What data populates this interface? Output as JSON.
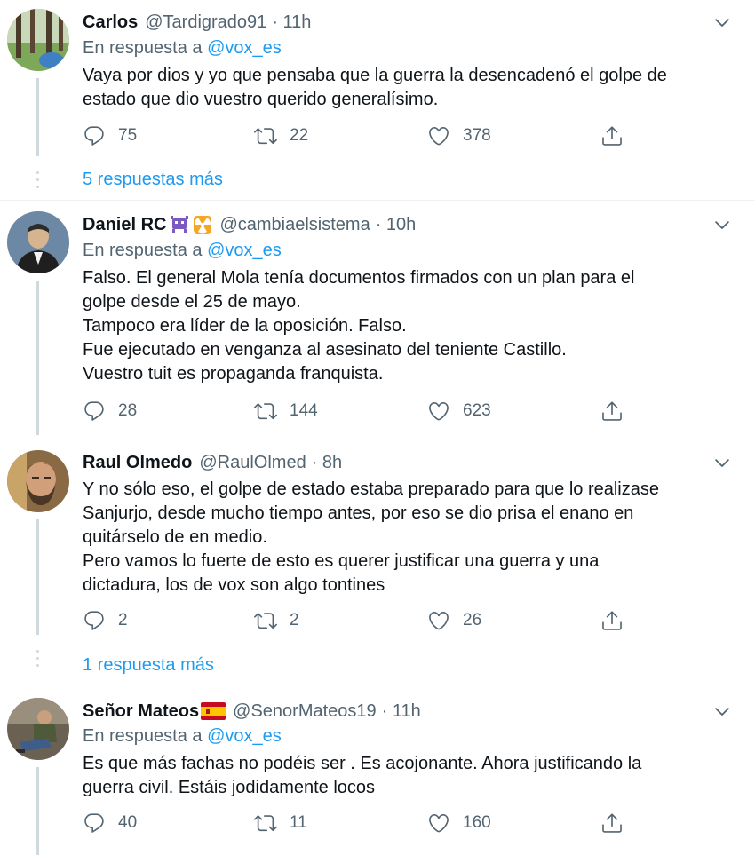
{
  "tweets": [
    {
      "name": "Carlos",
      "handle": "@Tardigrado91",
      "time": "· 11h",
      "reply_prefix": "En respuesta a",
      "reply_mention": "@vox_es",
      "lines": [
        "Vaya por dios y yo que pensaba que la guerra la desencadenó el golpe de",
        "estado que dio vuestro querido generalísimo."
      ],
      "replies": "75",
      "retweets": "22",
      "likes": "378",
      "more": "5 respuestas más"
    },
    {
      "name": "Daniel RC",
      "handle": "@cambiaelsistema",
      "time": "· 10h",
      "reply_prefix": "En respuesta a",
      "reply_mention": "@vox_es",
      "lines": [
        "Falso. El general Mola tenía documentos firmados con un plan para el",
        "golpe desde el 25 de mayo.",
        "Tampoco era líder de la oposición. Falso.",
        "Fue ejecutado en venganza al asesinato del teniente Castillo.",
        "Vuestro tuit es propaganda franquista."
      ],
      "replies": "28",
      "retweets": "144",
      "likes": "623"
    },
    {
      "name": "Raul Olmedo",
      "handle": "@RaulOlmed",
      "time": "· 8h",
      "lines": [
        "Y no sólo eso, el golpe de estado estaba preparado para que lo realizase",
        "Sanjurjo, desde mucho tiempo antes, por eso se dio prisa el enano en",
        "quitárselo de en medio.",
        "Pero vamos lo fuerte de esto es querer justificar una guerra y una",
        "dictadura, los de vox son algo tontines"
      ],
      "replies": "2",
      "retweets": "2",
      "likes": "26",
      "more": "1 respuesta más"
    },
    {
      "name": "Señor Mateos",
      "handle": "@SenorMateos19",
      "time": "· 11h",
      "reply_prefix": "En respuesta a",
      "reply_mention": "@vox_es",
      "lines": [
        "Es que más fachas no podéis ser . Es acojonante. Ahora justificando la",
        "guerra civil. Estáis jodidamente locos"
      ],
      "replies": "40",
      "retweets": "11",
      "likes": "160"
    }
  ],
  "icons": {
    "reply": "reply-icon",
    "retweet": "retweet-icon",
    "like": "heart-icon",
    "share": "share-icon",
    "caret": "chevron-down-icon"
  },
  "colors": {
    "link": "#1d9bf0",
    "muted": "#536471",
    "text": "#0f1419"
  }
}
